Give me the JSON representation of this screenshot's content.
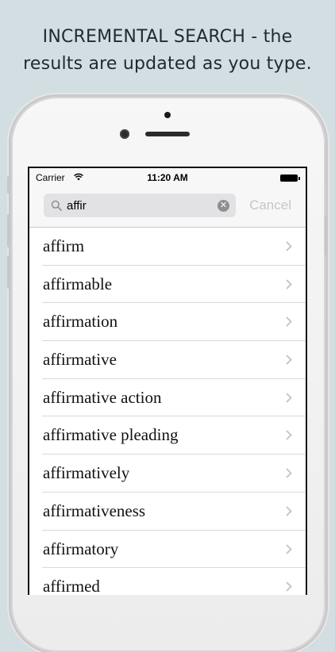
{
  "caption": {
    "line1": "INCREMENTAL SEARCH - the",
    "line2": "results are updated as you type."
  },
  "status_bar": {
    "carrier": "Carrier",
    "time": "11:20 AM"
  },
  "search": {
    "value": "affir",
    "cancel_label": "Cancel"
  },
  "results": [
    "affirm",
    "affirmable",
    "affirmation",
    "affirmative",
    "affirmative action",
    "affirmative pleading",
    "affirmatively",
    "affirmativeness",
    "affirmatory",
    "affirmed"
  ],
  "colors": {
    "background": "#d3dee3",
    "cancel_disabled": "#c6c6cb",
    "chevron": "#c7c7cc"
  }
}
